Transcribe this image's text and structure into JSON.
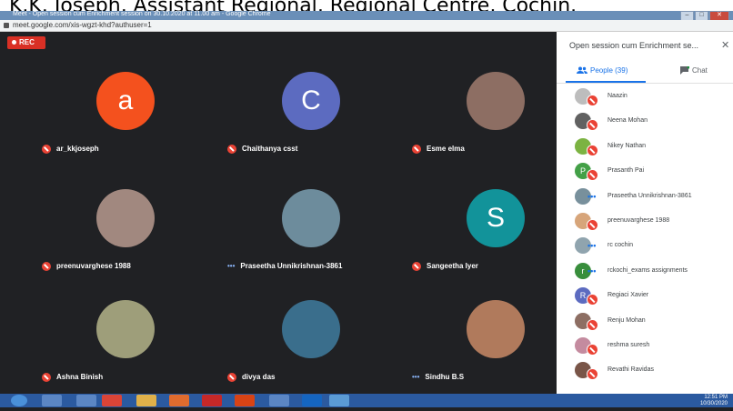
{
  "banner": {
    "text": "K.K. Joseph, Assistant Regional, Regional Centre, Cochin."
  },
  "window": {
    "title": "Meet - Open session cum Enrichment session on 30.10.2020 at 11.00 am - Google Chrome",
    "minimize": "–",
    "maximize": "□",
    "close": "✕"
  },
  "address": {
    "url": "meet.google.com/xis-wgzt-khd?authuser=1"
  },
  "rec": {
    "label": "REC"
  },
  "tiles": [
    {
      "name": "ar_kkjoseph",
      "initial": "a",
      "color": "#f4511e",
      "status": "muted"
    },
    {
      "name": "Chaithanya csst",
      "initial": "C",
      "color": "#5c6bc0",
      "status": "muted"
    },
    {
      "name": "Esme elma",
      "initial": "",
      "color": "#8d6e63",
      "status": "muted"
    },
    {
      "name": "preenuvarghese 1988",
      "initial": "",
      "color": "#a1887f",
      "status": "muted"
    },
    {
      "name": "Praseetha Unnikrishnan-3861",
      "initial": "",
      "color": "#6d8c9c",
      "status": "speaking"
    },
    {
      "name": "Sangeetha Iyer",
      "initial": "S",
      "color": "#12939a",
      "status": "muted"
    },
    {
      "name": "Ashna Binish",
      "initial": "",
      "color": "#9e9e7a",
      "status": "muted"
    },
    {
      "name": "divya das",
      "initial": "",
      "color": "#3a6e8c",
      "status": "muted"
    },
    {
      "name": "Sindhu B.S",
      "initial": "",
      "color": "#b07a5c",
      "status": "speaking"
    }
  ],
  "panel": {
    "title": "Open session cum Enrichment se...",
    "close": "✕",
    "people_tab": "People (39)",
    "chat_tab": "Chat",
    "people": [
      {
        "name": "Naazin",
        "initial": "",
        "color": "#bdbdbd",
        "status": "muted"
      },
      {
        "name": "Neena Mohan",
        "initial": "",
        "color": "#616161",
        "status": "muted"
      },
      {
        "name": "Nikey Nathan",
        "initial": "",
        "color": "#7cb342",
        "status": "muted"
      },
      {
        "name": "Prasanth Pai",
        "initial": "P",
        "color": "#43a047",
        "status": "muted"
      },
      {
        "name": "Praseetha Unnikrishnan-3861",
        "initial": "",
        "color": "#78909c",
        "status": "speaking"
      },
      {
        "name": "preenuvarghese 1988",
        "initial": "",
        "color": "#d7a57a",
        "status": "muted"
      },
      {
        "name": "rc cochin",
        "initial": "",
        "color": "#90a4ae",
        "status": "speaking"
      },
      {
        "name": "rckochi_exams assignments",
        "initial": "r",
        "color": "#388e3c",
        "status": "speaking"
      },
      {
        "name": "Regiaci Xavier",
        "initial": "R",
        "color": "#5c6bc0",
        "status": "muted"
      },
      {
        "name": "Renju Mohan",
        "initial": "",
        "color": "#8d6e63",
        "status": "muted"
      },
      {
        "name": "reshma suresh",
        "initial": "",
        "color": "#c48b9f",
        "status": "muted"
      },
      {
        "name": "Revathi Ravidas",
        "initial": "",
        "color": "#795548",
        "status": "muted"
      }
    ]
  },
  "taskbar": {
    "time": "12:51 PM",
    "date": "10/30/2020"
  }
}
